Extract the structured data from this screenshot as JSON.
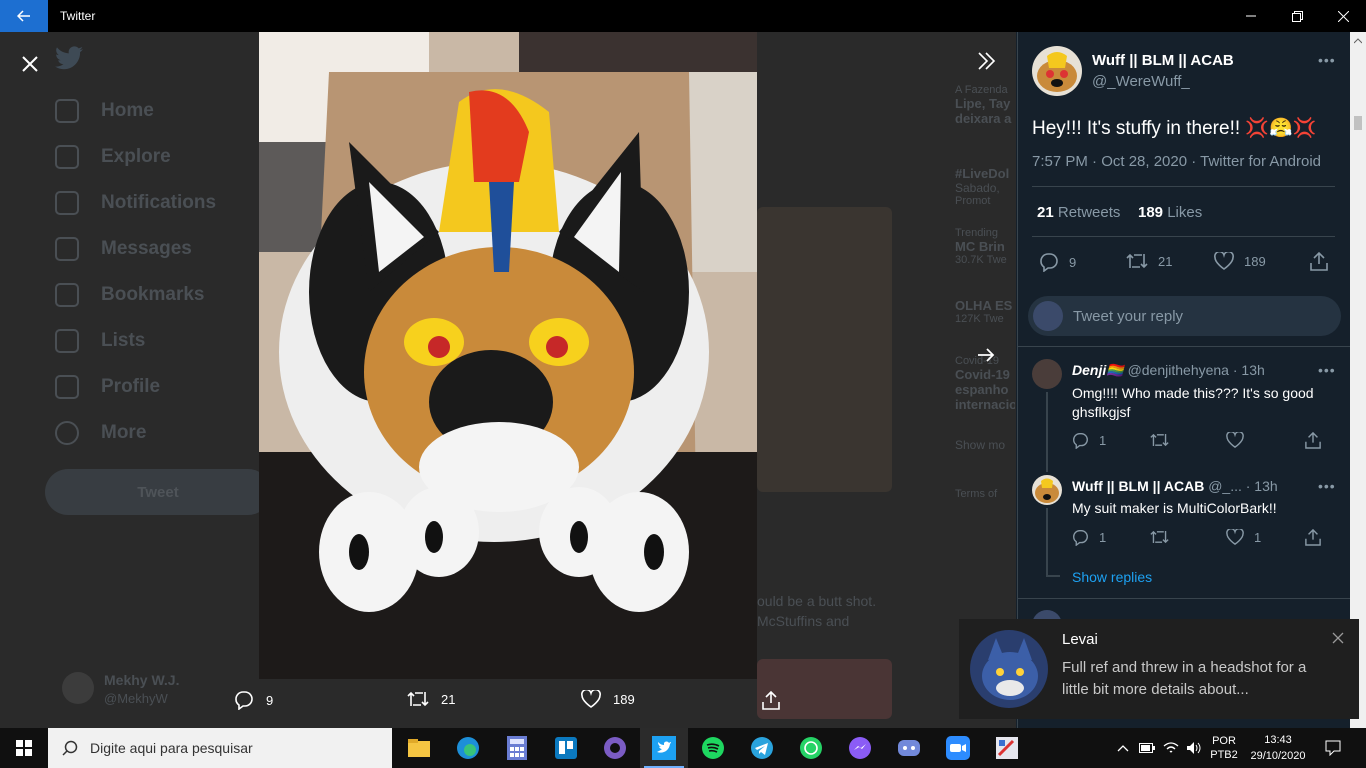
{
  "window": {
    "title": "Twitter"
  },
  "sidebar": {
    "items": [
      {
        "label": "Home"
      },
      {
        "label": "Explore"
      },
      {
        "label": "Notifications"
      },
      {
        "label": "Messages"
      },
      {
        "label": "Bookmarks"
      },
      {
        "label": "Lists"
      },
      {
        "label": "Profile"
      },
      {
        "label": "More"
      }
    ],
    "tweet_button": "Tweet",
    "account_name": "Mekhy W.J.",
    "account_handle": "@MekhyW"
  },
  "background": {
    "trends": [
      {
        "line1": "A Fazenda",
        "line2": "Lipe, Tay",
        "line3": "deixara a"
      },
      {
        "line1": "#LiveDol",
        "line2": "Sabado,",
        "line3": "Promot"
      },
      {
        "line1": "Trending",
        "line2": "MC Brin",
        "line3": "30.7K Twe"
      },
      {
        "line1": "OLHA ES",
        "line2": "127K Twe",
        "line3": ""
      },
      {
        "line1": "Covid-19",
        "line2": "Covid-19",
        "line3": "espanho"
      },
      {
        "line1": "internacio",
        "line2": "",
        "line3": "Show mo"
      }
    ],
    "snippet1": "ould be a butt shot.",
    "snippet2": "McStuffins and",
    "terms": "Terms of"
  },
  "media": {
    "replies": "9",
    "retweets": "21",
    "likes": "189"
  },
  "tweet": {
    "author_name": "Wuff || BLM || ACAB",
    "author_handle": "@_WereWuff_",
    "text": "Hey!!! It's stuffy in there!! 💢😤💢",
    "timestamp": "7:57 PM · Oct 28, 2020 · Twitter for Android",
    "retweet_count": "21",
    "retweet_label": "Retweets",
    "like_count": "189",
    "like_label": "Likes",
    "actions": {
      "replies": "9",
      "retweets": "21",
      "likes": "189"
    }
  },
  "reply_box": {
    "placeholder": "Tweet your reply"
  },
  "replies": [
    {
      "name": "Denji🏳️‍🌈",
      "handle": "@denjithehyena · 13h",
      "text": "Omg!!!! Who made this??? It's so good ghsflkgjsf",
      "replies": "1",
      "retweets": "",
      "likes": ""
    },
    {
      "name": "Wuff || BLM || ACAB",
      "handle": "@_... · 13h",
      "text": "My suit maker is MultiColorBark!!",
      "replies": "1",
      "retweets": "",
      "likes": "1"
    }
  ],
  "show_replies": "Show replies",
  "toast": {
    "title": "Levai",
    "body": "Full ref and threw in a headshot for a little bit more details about..."
  },
  "taskbar": {
    "search_placeholder": "Digite aqui para pesquisar",
    "lang1": "POR",
    "lang2": "PTB2",
    "time": "13:43",
    "date": "29/10/2020"
  },
  "colors": {
    "accent": "#1da1f2",
    "panel_bg": "#15202b",
    "muted": "#8899a6"
  }
}
